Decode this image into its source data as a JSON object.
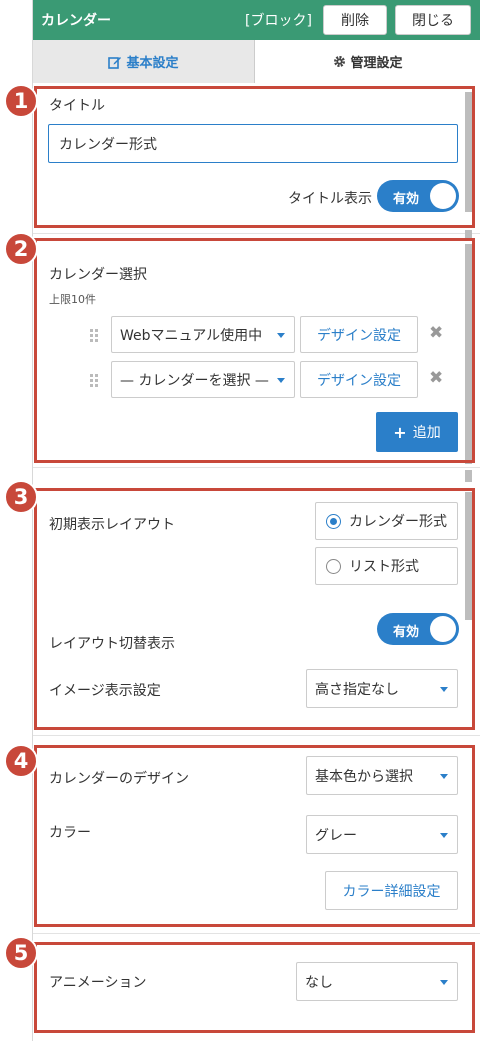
{
  "header": {
    "title": "カレンダー",
    "type": "[ブロック]",
    "delete_label": "削除",
    "close_label": "閉じる"
  },
  "tabs": [
    {
      "label": "基本設定"
    },
    {
      "label": "管理設定"
    }
  ],
  "badges": [
    "1",
    "2",
    "3",
    "4",
    "5"
  ],
  "section1": {
    "title_label": "タイトル",
    "title_value": "カレンダー形式",
    "title_display_label": "タイトル表示",
    "toggle_label": "有効"
  },
  "section2": {
    "calendar_select_label": "カレンダー選択",
    "limit_label": "上限10件",
    "rows": [
      {
        "select_value": "Webマニュアル使用中",
        "design_label": "デザイン設定"
      },
      {
        "select_value": "— カレンダーを選択 —",
        "design_label": "デザイン設定"
      }
    ],
    "add_label": "追加"
  },
  "section3": {
    "initial_layout_label": "初期表示レイアウト",
    "options": [
      "カレンダー形式",
      "リスト形式"
    ],
    "selected_option": "カレンダー形式",
    "layout_switch_label": "レイアウト切替表示",
    "toggle_label": "有効",
    "image_display_label": "イメージ表示設定",
    "image_display_value": "高さ指定なし"
  },
  "section4": {
    "design_label": "カレンダーのデザイン",
    "design_value": "基本色から選択",
    "color_label": "カラー",
    "color_value": "グレー",
    "color_detail_label": "カラー詳細設定"
  },
  "section5": {
    "animation_label": "アニメーション",
    "animation_value": "なし"
  },
  "colors": {
    "header": "#3a9a74",
    "accent": "#2b7fc9",
    "frame": "#c8483a"
  }
}
